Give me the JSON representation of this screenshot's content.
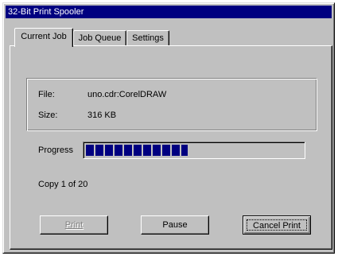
{
  "window": {
    "title": "32-Bit Print Spooler"
  },
  "tabs": [
    {
      "label": "Current Job",
      "active": true
    },
    {
      "label": "Job Queue",
      "active": false
    },
    {
      "label": "Settings",
      "active": false
    }
  ],
  "job": {
    "file_label": "File:",
    "file_value": "uno.cdr:CorelDRAW",
    "size_label": "Size:",
    "size_value": "316 KB"
  },
  "progress": {
    "label": "Progress",
    "fraction": 0.47
  },
  "copy_status": "Copy 1 of 20",
  "buttons": {
    "print": "Print",
    "pause": "Pause",
    "cancel": "Cancel Print"
  },
  "colors": {
    "title_bar": "#000080",
    "progress_fill": "#000080",
    "face": "#c0c0c0"
  }
}
